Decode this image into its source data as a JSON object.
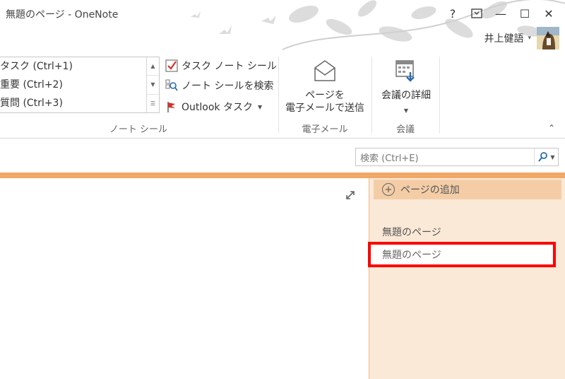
{
  "window": {
    "title": "無題のページ - OneNote",
    "buttons": {
      "help": "?",
      "ribbon_display": "⊡",
      "minimize": "—",
      "maximize": "☐",
      "close": "✕"
    },
    "user_name": "井上健語"
  },
  "ribbon": {
    "tag_gallery": {
      "items": [
        "タスク (Ctrl+1)",
        "重要 (Ctrl+2)",
        "質問 (Ctrl+3)"
      ]
    },
    "tag_commands": {
      "todo_tag": "タスク ノート シール",
      "find_tags": "ノート シールを検索",
      "outlook_tasks": "Outlook タスク"
    },
    "groups": {
      "tags": "ノート シール",
      "email": "電子メール",
      "meetings": "会議"
    },
    "email_button": {
      "line1": "ページを",
      "line2": "電子メールで送信"
    },
    "meeting_button": {
      "label": "会議の詳細"
    }
  },
  "search": {
    "placeholder": "検索 (Ctrl+E)"
  },
  "page_pane": {
    "add_page": "ページの追加",
    "section_title": "無題のページ",
    "pages": [
      "無題のページ"
    ]
  },
  "colors": {
    "accent_orange": "#f1a866",
    "pane_background": "#fbe9d8",
    "highlight_red": "#ff0000"
  }
}
